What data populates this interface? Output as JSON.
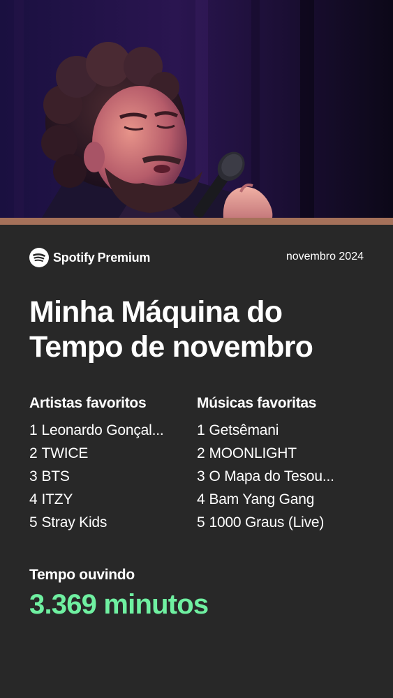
{
  "colors": {
    "background": "#282828",
    "text": "#ffffff",
    "highlight": "#6ff0a1",
    "accent_strip": "#a5715a",
    "brand_green": "#ffffff"
  },
  "hero": {
    "image_description_icon": "performer-photo"
  },
  "brand": {
    "logo_icon": "spotify-logo-icon",
    "name": "Spotify",
    "tier": "Premium"
  },
  "period": "novembro 2024",
  "title": {
    "line1": "Minha Máquina do",
    "line2": "Tempo de novembro"
  },
  "top_artists": {
    "heading": "Artistas favoritos",
    "items": [
      {
        "rank": "1",
        "name": "Leonardo Gonçal..."
      },
      {
        "rank": "2",
        "name": "TWICE"
      },
      {
        "rank": "3",
        "name": "BTS"
      },
      {
        "rank": "4",
        "name": "ITZY"
      },
      {
        "rank": "5",
        "name": "Stray Kids"
      }
    ]
  },
  "top_songs": {
    "heading": "Músicas favoritas",
    "items": [
      {
        "rank": "1",
        "name": "Getsêmani"
      },
      {
        "rank": "2",
        "name": "MOONLIGHT"
      },
      {
        "rank": "3",
        "name": "O Mapa do Tesou..."
      },
      {
        "rank": "4",
        "name": "Bam Yang Gang"
      },
      {
        "rank": "5",
        "name": "1000 Graus (Live)"
      }
    ]
  },
  "listening_time": {
    "label": "Tempo ouvindo",
    "value": "3.369 minutos"
  }
}
